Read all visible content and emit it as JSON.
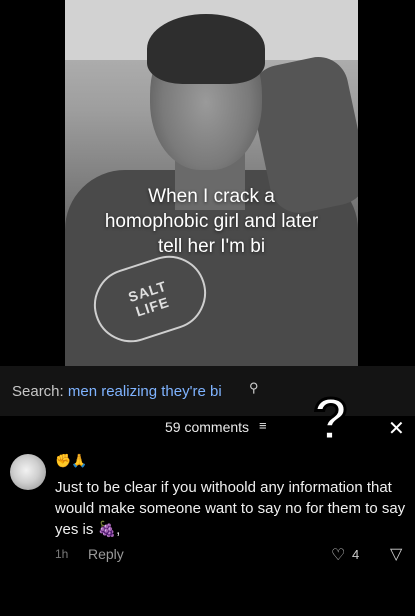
{
  "video": {
    "caption_lines": [
      "When I crack a",
      "homophobic girl and later",
      "tell her I'm bi"
    ],
    "shirt_text_top": "SALT",
    "shirt_text_bottom": "LIFE"
  },
  "search": {
    "label": "Search:",
    "query": "men realizing they're bi",
    "icon": "search-icon"
  },
  "comments": {
    "count_label": "59 comments",
    "filter_icon": "sort-icon",
    "close_icon": "close-icon"
  },
  "overlay": {
    "question_mark": "?"
  },
  "comment": {
    "emoji_line": "✊🙏",
    "text": "Just to be clear if you withoold any information that would make someone want to say no for them to say yes is 🍇,",
    "time": "1h",
    "reply_label": "Reply",
    "likes": "4"
  },
  "colors": {
    "background": "#000000",
    "search_bar": "#141414",
    "link_blue": "#7fb3ff"
  }
}
